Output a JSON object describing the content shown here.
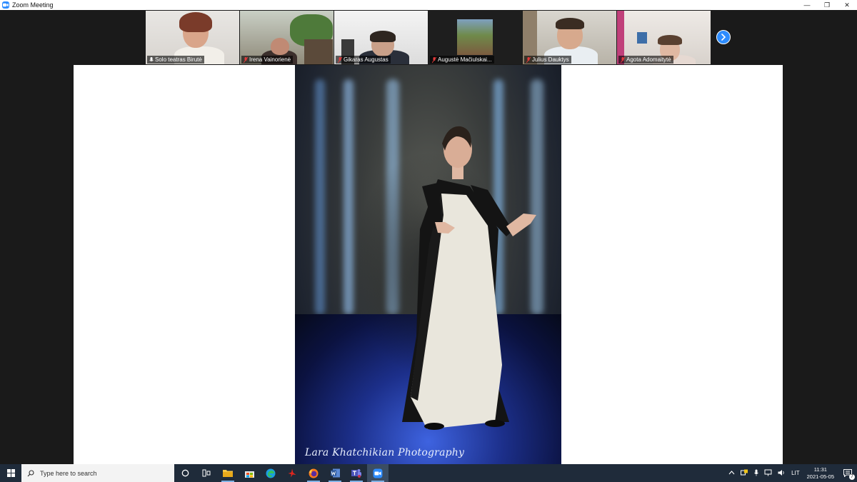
{
  "window": {
    "title": "Zoom Meeting",
    "minimize": "—",
    "restore": "❐",
    "close": "✕"
  },
  "participants": [
    {
      "name": "Solo teatras  Birutė",
      "mic": "unmuted",
      "active": true
    },
    {
      "name": "Irena Vainorienė",
      "mic": "muted",
      "active": false
    },
    {
      "name": "Gikaras Augustas",
      "mic": "muted",
      "active": false
    },
    {
      "name": "Augustė Mačiulskai...",
      "mic": "muted",
      "active": false
    },
    {
      "name": "Julius Dauktys",
      "mic": "muted",
      "active": false
    },
    {
      "name": "Agota Adomaitytė",
      "mic": "muted",
      "active": false
    }
  ],
  "shared_screen": {
    "photo_credit": "Lara Khatchikian Photography"
  },
  "taskbar": {
    "search_placeholder": "Type here to search",
    "apps": [
      "cortana-icon",
      "task-view-icon",
      "file-explorer-icon",
      "store-icon",
      "edge-icon",
      "acrobat-icon",
      "firefox-icon",
      "word-icon",
      "teams-icon",
      "zoom-icon"
    ],
    "tray": {
      "language": "LIT",
      "time": "11:31",
      "date": "2021-05-05",
      "notifications": "7"
    }
  },
  "colors": {
    "zoom_blue": "#2d8cff",
    "active_speaker": "#a6d84a",
    "taskbar": "#1f2b3a"
  }
}
